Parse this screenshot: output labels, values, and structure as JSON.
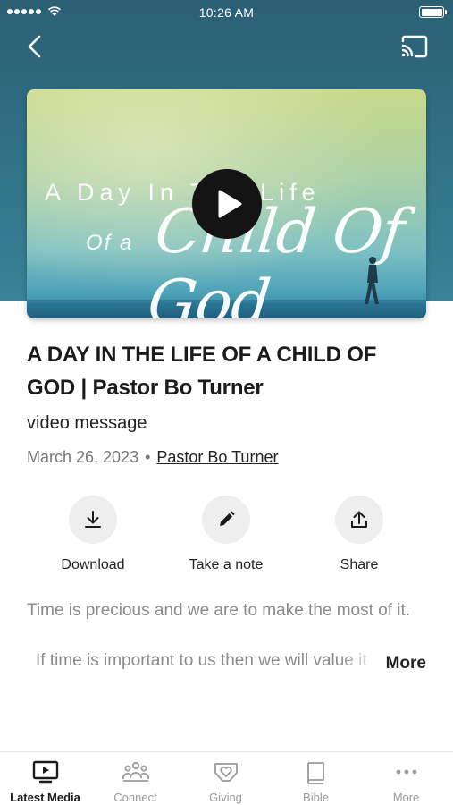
{
  "status_bar": {
    "time": "10:26 AM"
  },
  "video": {
    "art_line1": "A Day In The Life",
    "art_of_a": "Of a",
    "art_script": "Child Of God"
  },
  "sermon": {
    "title": "A DAY IN THE LIFE OF A CHILD OF GOD | Pastor Bo Turner",
    "type": "video message",
    "date": "March 26, 2023",
    "separator": "•",
    "author": "Pastor Bo Turner"
  },
  "actions": {
    "download": "Download",
    "note": "Take a note",
    "share": "Share"
  },
  "description": {
    "line1": "Time is precious and we are to make the most of it.",
    "line2": "If time is important to us then we will value it",
    "more": "More"
  },
  "tabs": [
    {
      "label": "Latest Media",
      "icon": "tv-play-icon",
      "active": true
    },
    {
      "label": "Connect",
      "icon": "people-icon",
      "active": false
    },
    {
      "label": "Giving",
      "icon": "handshake-heart-icon",
      "active": false
    },
    {
      "label": "Bible",
      "icon": "book-icon",
      "active": false
    },
    {
      "label": "More",
      "icon": "ellipsis-icon",
      "active": false
    }
  ],
  "colors": {
    "header_bg": "#2f6f84",
    "text_primary": "#1b1b1b",
    "text_secondary": "#8a8a8a",
    "action_circle": "#eeeeee",
    "play_button": "#141414"
  }
}
